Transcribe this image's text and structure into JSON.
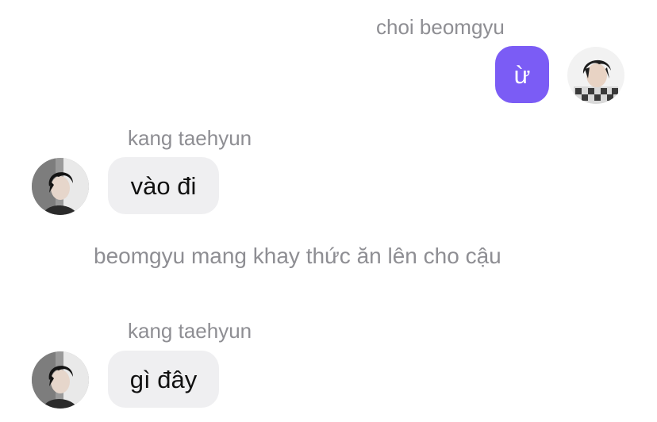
{
  "messages": [
    {
      "sender": "choi beomgyu",
      "text": "ừ",
      "direction": "outgoing",
      "avatar_icon": "beomgyu-avatar-icon"
    },
    {
      "sender": "kang taehyun",
      "text": "vào đi",
      "direction": "incoming",
      "avatar_icon": "taehyun-avatar-icon"
    },
    {
      "type": "narration",
      "text": "beomgyu mang khay thức ăn lên cho cậu"
    },
    {
      "sender": "kang taehyun",
      "text": "gì đây",
      "direction": "incoming",
      "avatar_icon": "taehyun-avatar-icon"
    }
  ],
  "colors": {
    "outgoing_bubble": "#7b5cf5",
    "incoming_bubble": "#efeff1",
    "name_text": "#8e8e93",
    "narration_text": "#8e8e93"
  }
}
